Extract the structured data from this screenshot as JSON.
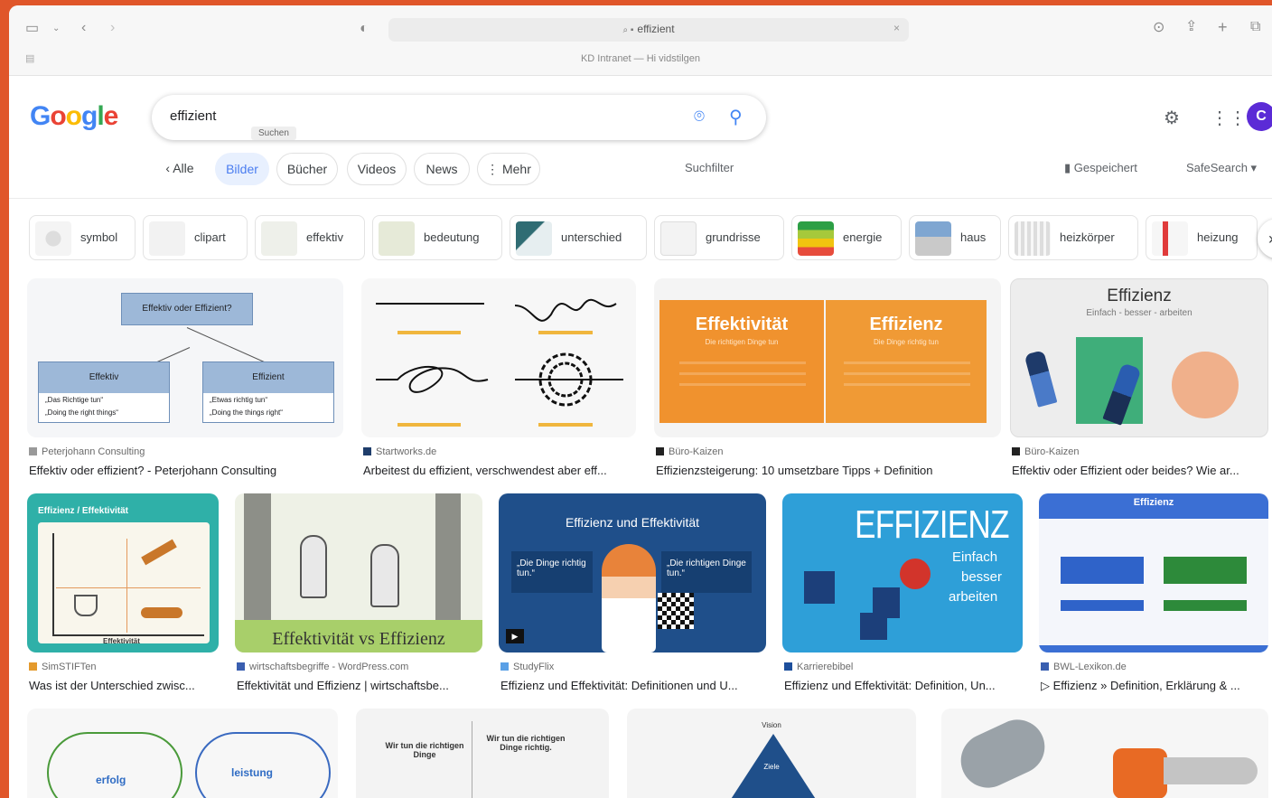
{
  "browser": {
    "url_text": "effizient",
    "tab_line": "KD Intranet — Hi vidstilgen"
  },
  "google": {
    "logo": "Google",
    "query": "effizient",
    "tooltip": "Suchen",
    "avatar_letter": "C"
  },
  "nav": {
    "back": "Alle",
    "tabs": [
      "Bilder",
      "Bücher",
      "Videos",
      "News",
      "Mehr"
    ],
    "filter": "Suchfilter",
    "saved": "Gespeichert",
    "safesearch": "SafeSearch"
  },
  "chips": [
    "symbol",
    "clipart",
    "effektiv",
    "bedeutung",
    "unterschied",
    "grundrisse",
    "energie",
    "haus",
    "heizkörper",
    "heizung"
  ],
  "results": [
    {
      "source": "Peterjohann Consulting",
      "title": "Effektiv oder effizient? - Peterjohann Consulting",
      "overlay": {
        "box_top": "Effektiv oder Effizient?",
        "left_head": "Effektiv",
        "right_head": "Effizient",
        "left_1": "„Das Richtige tun“",
        "left_2": "„Doing the right things“",
        "right_1": "„Etwas richtig tun“",
        "right_2": "„Doing the things right“"
      }
    },
    {
      "source": "Startworks.de",
      "title": "Arbeitest du effizient, verschwendest aber eff..."
    },
    {
      "source": "Büro-Kaizen",
      "title": "Effizienzsteigerung: 10 umsetzbare Tipps + Definition",
      "overlay": {
        "left": "Effektivität",
        "right": "Effizienz",
        "left_sub": "Die richtigen Dinge tun",
        "right_sub": "Die Dinge richtig tun"
      }
    },
    {
      "source": "Büro-Kaizen",
      "title": "Effektiv oder Effizient oder beides? Wie ar...",
      "overlay": {
        "head": "Effizienz",
        "sub": "Einfach - besser - arbeiten"
      }
    },
    {
      "source": "SimSTIFTen",
      "title": "Was ist der Unterschied zwisc...",
      "overlay": {
        "head": "Effizienz / Effektivität",
        "axis": "Effektivität"
      }
    },
    {
      "source": "wirtschaftsbegriffe - WordPress.com",
      "title": "Effektivität und Effizienz | wirtschaftsbe...",
      "overlay": {
        "caption": "Effektivität vs Effizienz"
      }
    },
    {
      "source": "StudyFlix",
      "title": "Effizienz und Effektivität: Definitionen und U...",
      "overlay": {
        "head": "Effizienz und Effektivität",
        "left": "„Die Dinge richtig tun.“",
        "right": "„Die richtigen Dinge tun.“"
      }
    },
    {
      "source": "Karrierebibel",
      "title": "Effizienz und Effektivität: Definition, Un...",
      "overlay": {
        "head": "EFFIZIENZ",
        "sub1": "Einfach",
        "sub2": "besser",
        "sub3": "arbeiten"
      }
    },
    {
      "source": "BWL-Lexikon.de",
      "title": "Effizienz » Definition, Erklärung & ...",
      "overlay": {
        "head": "Effizienz"
      }
    },
    {
      "overlay": {
        "word": "erfolg",
        "word2": "leistung"
      }
    },
    {
      "overlay": {
        "left": "Wir tun die richtigen Dinge",
        "right": "Wir tun die richtigen Dinge richtig."
      }
    },
    {
      "overlay": {
        "top": "Vision",
        "mid": "Ziele"
      }
    },
    {}
  ],
  "colors": {
    "accent": "#4285f4",
    "frame": "#e0562a",
    "avatar": "#5b2bd6",
    "orange": "#f0922e"
  }
}
